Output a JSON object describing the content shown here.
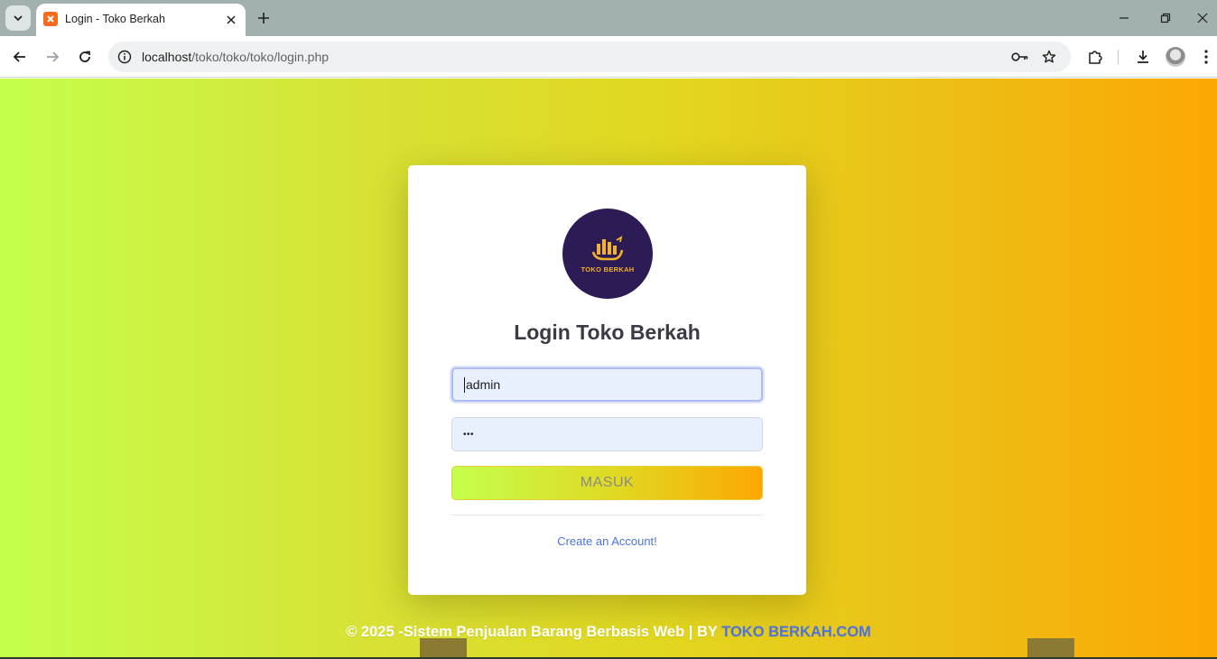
{
  "browser": {
    "tab_title": "Login - Toko Berkah",
    "url_host": "localhost",
    "url_path": "/toko/toko/toko/login.php"
  },
  "page": {
    "logo_text": "TOKO BERKAH",
    "title": "Login Toko Berkah",
    "username_value": "admin",
    "password_value": "•••",
    "submit_label": "MASUK",
    "create_account_label": "Create an Account!",
    "footer_text": "© 2025 -Sistem Penjualan Barang Berbasis Web | BY ",
    "footer_brand": "TOKO BERKAH.COM"
  },
  "colors": {
    "gradient_start": "#c4ff4c",
    "gradient_end": "#fda702",
    "logo_bg": "#2c1b55",
    "logo_accent": "#f4b324",
    "link": "#4e73df",
    "title": "#3a3b45"
  },
  "icons": {
    "tab_favicon": "xampp-icon",
    "back": "arrow-left-icon",
    "forward": "arrow-right-icon",
    "reload": "reload-icon",
    "site_info": "info-icon",
    "password_manager": "key-icon",
    "bookmark": "star-icon",
    "extensions": "puzzle-icon",
    "downloads": "download-icon",
    "menu": "kebab-icon"
  }
}
